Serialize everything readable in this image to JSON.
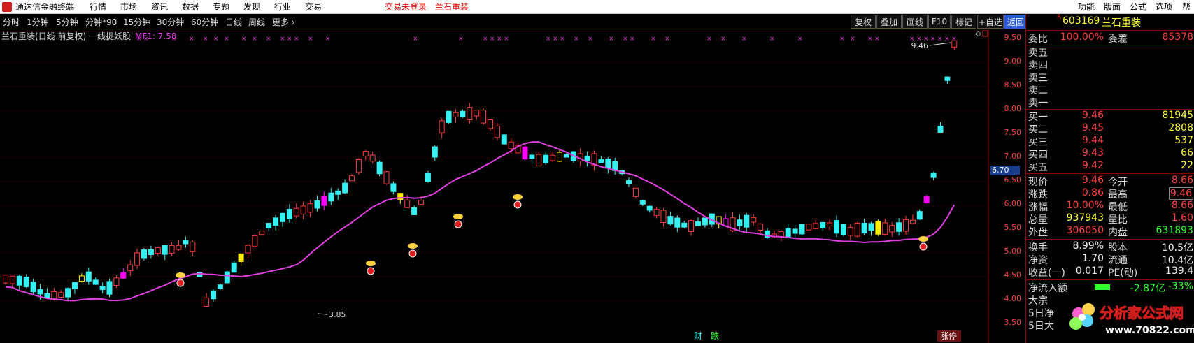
{
  "menubar": {
    "app_title": "通达信金融终端",
    "items": [
      "行情",
      "市场",
      "资讯",
      "数据",
      "专题",
      "发现",
      "行业",
      "交易"
    ],
    "trade_status": "交易未登录",
    "stock_link": "兰石重装",
    "right_items": [
      "功能",
      "版面",
      "公式",
      "选项",
      "帮"
    ]
  },
  "periods": [
    "分时",
    "1分钟",
    "5分钟",
    "分钟*90",
    "15分钟",
    "30分钟",
    "60分钟",
    "日线",
    "周线",
    "更多 ›"
  ],
  "toolbar": [
    "复权",
    "叠加",
    "画线",
    "F10",
    "标记",
    "+自选",
    "返回"
  ],
  "chart": {
    "title": "兰石重装(日线 前复权) 一线捉妖股",
    "mf_label": "MF1: 7.58",
    "high_label": "9.46",
    "low_label": "3.85",
    "bottom_marks": [
      "财",
      "跌",
      "涨停"
    ],
    "price_tag": "6.70",
    "y_ticks": [
      "9.50",
      "9.00",
      "8.50",
      "8.00",
      "7.50",
      "7.00",
      "6.50",
      "6.00",
      "5.50",
      "5.00",
      "4.50",
      "4.00",
      "3.50"
    ],
    "up_color": "#ff3c3c",
    "down_color": "#35f0f0",
    "signal_yellow": "#ffee00",
    "signal_magenta": "#ff00ff",
    "ma_color": "#e040e0"
  },
  "quote": {
    "code": "603169",
    "name": "兰石重装",
    "r_badge": "R",
    "weibi_label": "委比",
    "weibi_value": "100.00%",
    "weicha_label": "委差",
    "weicha_value": "85378",
    "sell": [
      {
        "label": "卖五",
        "price": "",
        "vol": ""
      },
      {
        "label": "卖四",
        "price": "",
        "vol": ""
      },
      {
        "label": "卖三",
        "price": "",
        "vol": ""
      },
      {
        "label": "卖二",
        "price": "",
        "vol": ""
      },
      {
        "label": "卖一",
        "price": "",
        "vol": ""
      }
    ],
    "buy": [
      {
        "label": "买一",
        "price": "9.46",
        "vol": "81945"
      },
      {
        "label": "买二",
        "price": "9.45",
        "vol": "2808"
      },
      {
        "label": "买三",
        "price": "9.44",
        "vol": "537"
      },
      {
        "label": "买四",
        "price": "9.43",
        "vol": "66"
      },
      {
        "label": "买五",
        "price": "9.42",
        "vol": "22"
      }
    ],
    "stats": [
      {
        "l1": "现价",
        "v1": "9.46",
        "c1": "red",
        "l2": "今开",
        "v2": "8.66",
        "c2": "red"
      },
      {
        "l1": "涨跌",
        "v1": "0.86",
        "c1": "red",
        "l2": "最高",
        "v2": "9.46",
        "c2": "red"
      },
      {
        "l1": "涨幅",
        "v1": "10.00%",
        "c1": "red",
        "l2": "最低",
        "v2": "8.66",
        "c2": "red"
      },
      {
        "l1": "总量",
        "v1": "937943",
        "c1": "yellow",
        "l2": "量比",
        "v2": "1.60",
        "c2": "red"
      },
      {
        "l1": "外盘",
        "v1": "306050",
        "c1": "red",
        "l2": "内盘",
        "v2": "631893",
        "c2": "green"
      }
    ],
    "fund": [
      {
        "l1": "换手",
        "v1": "8.99%",
        "c1": "white",
        "l2": "股本",
        "v2": "10.5亿",
        "c2": "white"
      },
      {
        "l1": "净资",
        "v1": "1.70",
        "c1": "white",
        "l2": "流通",
        "v2": "10.4亿",
        "c2": "white"
      },
      {
        "l1": "收益(一)",
        "v1": "0.017",
        "c1": "white",
        "l2": "PE(动)",
        "v2": "139.4",
        "c2": "white"
      }
    ],
    "netflow_label": "净流入额",
    "netflow_value": "-2.87亿",
    "netflow_pct": "-33%",
    "bottom_labels": [
      "大宗",
      "5日净",
      "5日大"
    ]
  },
  "watermark": {
    "line1": "分析家公式网",
    "line2": "www.70822.com"
  }
}
